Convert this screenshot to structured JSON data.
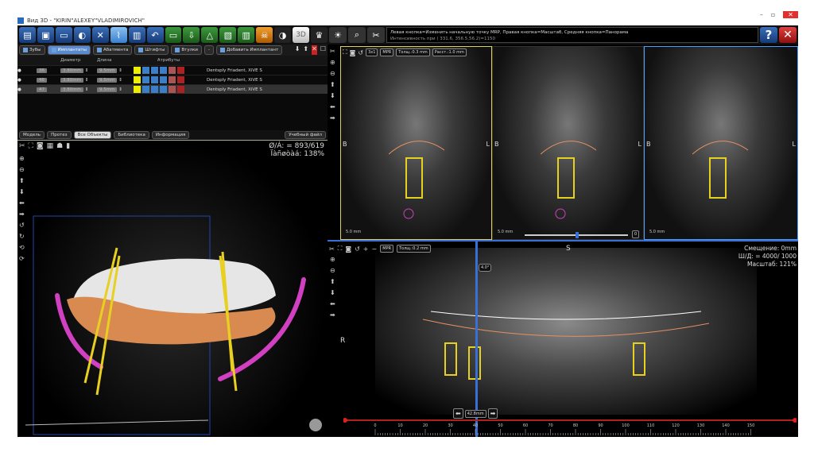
{
  "window": {
    "title": "Вид 3D  -  \"KIRIN\"ALEXEY\"VLADIMIROVICH\"",
    "minimize": "–",
    "maximize": "▫",
    "close": "✕"
  },
  "toolbar": {
    "buttons": [
      "open-icon",
      "save-icon",
      "comment-icon",
      "settings-icon",
      "tools-icon",
      "implant-icon",
      "trash-icon",
      "undo-icon",
      "measure-icon",
      "export-icon",
      "angle-icon",
      "report-icon",
      "delete-icon",
      "nerve-icon",
      "contrast-icon",
      "3d-icon",
      "crown-icon",
      "light-icon",
      "search-icon",
      "scissors-icon"
    ],
    "label_3d": "3D"
  },
  "infobar": {
    "line1": "Левая кнопка=Изменить начальную точку MRP, Правая кнопка=Масштаб, Средняя кнопка=Панорама",
    "line2": "Интенсивность при ( 331.6, 356.5,56.2)=1150",
    "help": "?",
    "close": "✕"
  },
  "tabs": [
    {
      "label": "Зубы"
    },
    {
      "label": "Имплантаты",
      "active": true
    },
    {
      "label": "Абатмента"
    },
    {
      "label": "Штифты"
    },
    {
      "label": "Втулки"
    },
    {
      "label": "-"
    },
    {
      "label": "Добавить Имплантант"
    }
  ],
  "table": {
    "headers": [
      "Диаметр",
      "Длина",
      "Атрибуты"
    ],
    "rows": [
      {
        "tooth": "36",
        "diameter": "3.80mm",
        "length": "9.5mm",
        "model": "Dentsply Friadent, XiVE S"
      },
      {
        "tooth": "46",
        "diameter": "3.80mm",
        "length": "9.5mm",
        "model": "Dentsply Friadent, XiVE S"
      },
      {
        "tooth": "47",
        "diameter": "3.80mm",
        "length": "9.5mm",
        "model": "Dentsply Friadent, XiVE S"
      }
    ]
  },
  "subtabs": [
    {
      "label": "Модель"
    },
    {
      "label": "Протез"
    },
    {
      "label": "Все Объекты",
      "active": true
    },
    {
      "label": "Библиотека"
    },
    {
      "label": "Информация"
    },
    {
      "label": "Учебный файл"
    }
  ],
  "view3d": {
    "readout1": "Ø/Á: = 893/619",
    "readout2": "Ïàñøòàá: 138%"
  },
  "views": {
    "btn_layout": "3x1",
    "btn_mpr": "MPR",
    "thickness": "Толщ.:0.3 mm",
    "distance": "Расст.:1.0 mm",
    "left": "B",
    "right": "L",
    "scale": "5.0 mm",
    "slider_value": "0"
  },
  "pano": {
    "btn_mpr": "MPR",
    "thickness": "Толщ.:0.2 mm",
    "top": "S",
    "left": "R",
    "angle": "4.0°",
    "offset": "Смещение: 0mm",
    "wl": "Ш/Д: = 4000/ 1000",
    "zoom": "Масштаб: 121%",
    "position": "42.8mm",
    "ruler": [
      "0",
      "10",
      "20",
      "30",
      "40",
      "50",
      "60",
      "70",
      "80",
      "90",
      "100",
      "110",
      "120",
      "130",
      "140",
      "150"
    ]
  },
  "colors": {
    "accent": "#3a6fd8",
    "implant": "#e8d020",
    "nerve": "#d040c0",
    "active_border": "#e0d060"
  }
}
